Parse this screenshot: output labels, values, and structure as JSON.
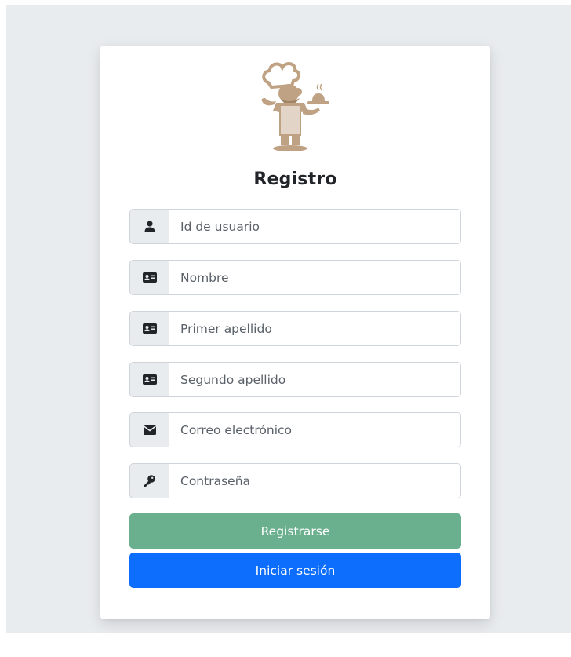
{
  "form": {
    "title": "Registro",
    "fields": [
      {
        "name": "user-id",
        "icon": "user-icon",
        "placeholder": "Id de usuario",
        "value": ""
      },
      {
        "name": "first-name",
        "icon": "id-card-icon",
        "placeholder": "Nombre",
        "value": ""
      },
      {
        "name": "first-surname",
        "icon": "id-card-icon",
        "placeholder": "Primer apellido",
        "value": ""
      },
      {
        "name": "second-surname",
        "icon": "id-card-icon",
        "placeholder": "Segundo apellido",
        "value": ""
      },
      {
        "name": "email",
        "icon": "envelope-icon",
        "placeholder": "Correo electrónico",
        "value": ""
      },
      {
        "name": "password",
        "icon": "key-icon",
        "placeholder": "Contraseña",
        "value": ""
      }
    ],
    "register_label": "Registrarse",
    "login_label": "Iniciar sesión"
  },
  "colors": {
    "page_background": "#e9ecef",
    "register_button": "#6aaf8e",
    "login_button": "#0d6efd",
    "logo": "#bfa283"
  },
  "logo": {
    "icon": "chef-logo-icon"
  }
}
